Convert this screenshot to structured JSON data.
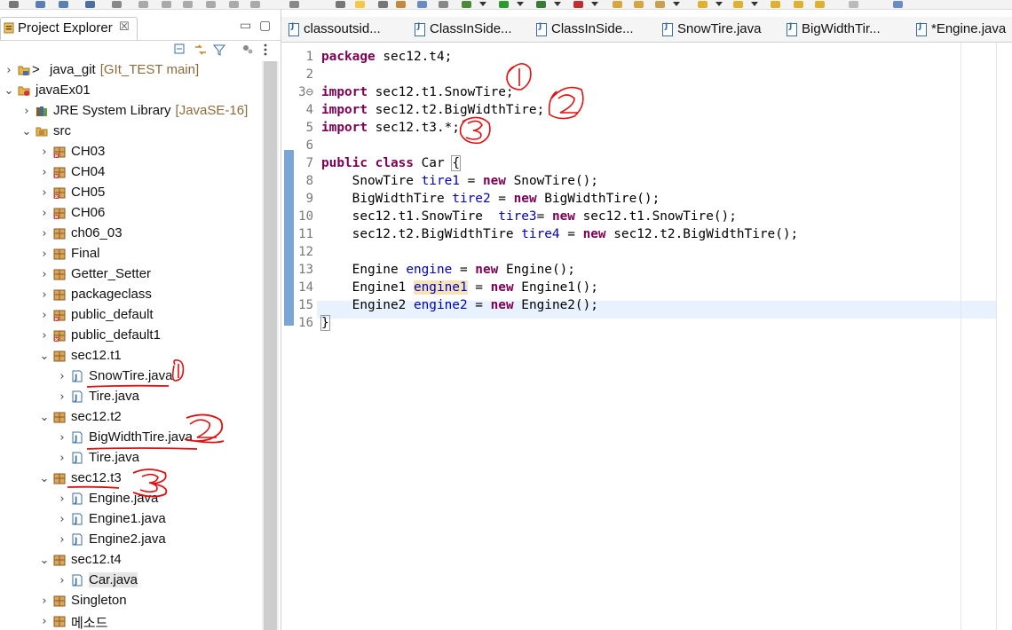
{
  "explorer": {
    "tab_label": "Project Explorer",
    "close_glyph": "☒",
    "minimize_glyph": "▭",
    "maximize_glyph": "▢",
    "tree": [
      {
        "label": "java_git",
        "decoration": "[GIt_TEST main]",
        "prefix": ">",
        "icon": "git-project-icon",
        "expanded": false,
        "level": 0
      },
      {
        "label": "javaEx01",
        "decoration": "",
        "prefix": "",
        "icon": "java-project-icon",
        "expanded": true,
        "level": 0
      },
      {
        "label": "JRE System Library",
        "decoration": "[JavaSE-16]",
        "prefix": "",
        "icon": "library-icon",
        "expanded": false,
        "level": 1
      },
      {
        "label": "src",
        "decoration": "",
        "prefix": "",
        "icon": "source-folder-icon",
        "expanded": true,
        "level": 1
      },
      {
        "label": "CH03",
        "icon": "package-error-icon",
        "expanded": false,
        "level": 2
      },
      {
        "label": "CH04",
        "icon": "package-error-icon",
        "expanded": false,
        "level": 2
      },
      {
        "label": "CH05",
        "icon": "package-error-icon",
        "expanded": false,
        "level": 2
      },
      {
        "label": "CH06",
        "icon": "package-error-icon",
        "expanded": false,
        "level": 2
      },
      {
        "label": "ch06_03",
        "icon": "package-icon",
        "expanded": false,
        "level": 2
      },
      {
        "label": "Final",
        "icon": "package-icon",
        "expanded": false,
        "level": 2
      },
      {
        "label": "Getter_Setter",
        "icon": "package-icon",
        "expanded": false,
        "level": 2
      },
      {
        "label": "packageclass",
        "icon": "package-icon",
        "expanded": false,
        "level": 2
      },
      {
        "label": "public_default",
        "icon": "package-error-icon",
        "expanded": false,
        "level": 2
      },
      {
        "label": "public_default1",
        "icon": "package-error-icon",
        "expanded": false,
        "level": 2
      },
      {
        "label": "sec12.t1",
        "icon": "package-icon",
        "expanded": true,
        "level": 2
      },
      {
        "label": "SnowTire.java",
        "icon": "java-file-icon",
        "expanded": false,
        "level": 3
      },
      {
        "label": "Tire.java",
        "icon": "java-file-icon",
        "expanded": false,
        "level": 3
      },
      {
        "label": "sec12.t2",
        "icon": "package-icon",
        "expanded": true,
        "level": 2
      },
      {
        "label": "BigWidthTire.java",
        "icon": "java-file-icon",
        "expanded": false,
        "level": 3
      },
      {
        "label": "Tire.java",
        "icon": "java-file-icon",
        "expanded": false,
        "level": 3
      },
      {
        "label": "sec12.t3",
        "icon": "package-icon",
        "expanded": true,
        "level": 2
      },
      {
        "label": "Engine.java",
        "icon": "java-file-icon",
        "expanded": false,
        "level": 3
      },
      {
        "label": "Engine1.java",
        "icon": "java-file-icon",
        "expanded": false,
        "level": 3
      },
      {
        "label": "Engine2.java",
        "icon": "java-file-icon",
        "expanded": false,
        "level": 3
      },
      {
        "label": "sec12.t4",
        "icon": "package-icon",
        "expanded": true,
        "level": 2
      },
      {
        "label": "Car.java",
        "icon": "java-file-icon",
        "expanded": false,
        "level": 3,
        "selected": true
      },
      {
        "label": "Singleton",
        "icon": "package-icon",
        "expanded": false,
        "level": 2
      },
      {
        "label": "메소드",
        "icon": "package-icon",
        "expanded": false,
        "level": 2
      }
    ]
  },
  "editor": {
    "tabs": [
      {
        "label": "classoutsid..."
      },
      {
        "label": "ClassInSide..."
      },
      {
        "label": "ClassInSide..."
      },
      {
        "label": "SnowTire.java"
      },
      {
        "label": "BigWidthTir..."
      },
      {
        "label": "*Engine.java"
      }
    ],
    "line_numbers": [
      "1",
      "2",
      "3⊖",
      "4",
      "5",
      "6",
      "7",
      "8",
      "9",
      "10",
      "11",
      "12",
      "13",
      "14",
      "15",
      "16"
    ],
    "code_lines": [
      {
        "parts": [
          {
            "t": "package",
            "c": "kw"
          },
          {
            "t": " sec12.t4;",
            "c": ""
          }
        ]
      },
      {
        "parts": []
      },
      {
        "parts": [
          {
            "t": "import",
            "c": "kw"
          },
          {
            "t": " sec12.t1.SnowTire;",
            "c": ""
          }
        ]
      },
      {
        "parts": [
          {
            "t": "import",
            "c": "kw"
          },
          {
            "t": " sec12.t2.BigWidthTire;",
            "c": ""
          }
        ]
      },
      {
        "parts": [
          {
            "t": "import",
            "c": "kw"
          },
          {
            "t": " sec12.t3.*;",
            "c": ""
          }
        ]
      },
      {
        "parts": []
      },
      {
        "parts": [
          {
            "t": "public",
            "c": "kw"
          },
          {
            "t": " ",
            "c": ""
          },
          {
            "t": "class",
            "c": "kw"
          },
          {
            "t": " Car ",
            "c": ""
          },
          {
            "t": "{",
            "c": "bracket"
          }
        ]
      },
      {
        "parts": [
          {
            "t": "    SnowTire ",
            "c": ""
          },
          {
            "t": "tire1",
            "c": "var"
          },
          {
            "t": " = ",
            "c": ""
          },
          {
            "t": "new",
            "c": "kw"
          },
          {
            "t": " SnowTire();",
            "c": ""
          }
        ]
      },
      {
        "parts": [
          {
            "t": "    BigWidthTire ",
            "c": ""
          },
          {
            "t": "tire2",
            "c": "var"
          },
          {
            "t": " = ",
            "c": ""
          },
          {
            "t": "new",
            "c": "kw"
          },
          {
            "t": " BigWidthTire();",
            "c": ""
          }
        ]
      },
      {
        "parts": [
          {
            "t": "    sec12.t1.SnowTire  ",
            "c": ""
          },
          {
            "t": "tire3",
            "c": "var"
          },
          {
            "t": "= ",
            "c": ""
          },
          {
            "t": "new",
            "c": "kw"
          },
          {
            "t": " sec12.t1.SnowTire();",
            "c": ""
          }
        ]
      },
      {
        "parts": [
          {
            "t": "    sec12.t2.BigWidthTire ",
            "c": ""
          },
          {
            "t": "tire4",
            "c": "var"
          },
          {
            "t": " = ",
            "c": ""
          },
          {
            "t": "new",
            "c": "kw"
          },
          {
            "t": " sec12.t2.BigWidthTire();",
            "c": ""
          }
        ]
      },
      {
        "parts": []
      },
      {
        "parts": [
          {
            "t": "    Engine ",
            "c": ""
          },
          {
            "t": "engine",
            "c": "var"
          },
          {
            "t": " = ",
            "c": ""
          },
          {
            "t": "new",
            "c": "kw"
          },
          {
            "t": " Engine();",
            "c": ""
          }
        ]
      },
      {
        "parts": [
          {
            "t": "    Engine1 ",
            "c": ""
          },
          {
            "t": "engine1",
            "c": "var occ"
          },
          {
            "t": " = ",
            "c": ""
          },
          {
            "t": "new",
            "c": "kw"
          },
          {
            "t": " Engine1();",
            "c": ""
          }
        ]
      },
      {
        "parts": [
          {
            "t": "    Engine2 ",
            "c": ""
          },
          {
            "t": "engine2",
            "c": "var"
          },
          {
            "t": " = ",
            "c": ""
          },
          {
            "t": "new",
            "c": "kw"
          },
          {
            "t": " Engine2();",
            "c": ""
          }
        ]
      },
      {
        "parts": [
          {
            "t": "}",
            "c": "bracket"
          }
        ]
      }
    ]
  },
  "annotations": [
    "1",
    "2",
    "3"
  ],
  "colors": {
    "keyword": "#7f0055",
    "field": "#0000c0",
    "annotation": "#e01010",
    "current_line": "#e8f2fe"
  }
}
